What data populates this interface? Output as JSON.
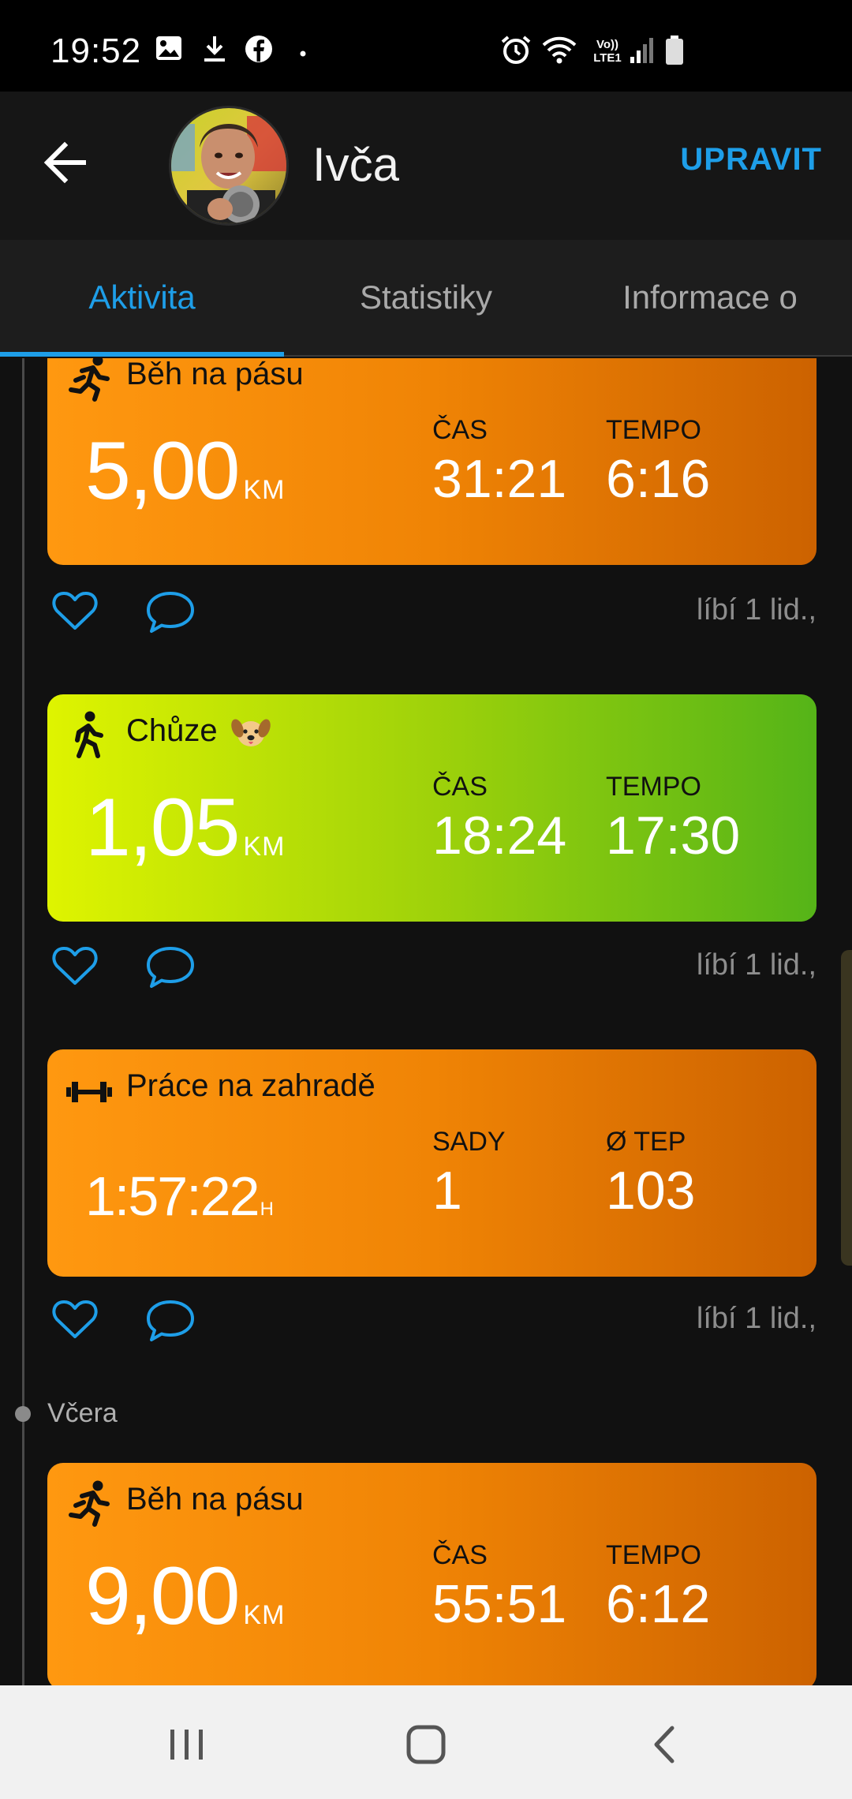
{
  "status_bar": {
    "time": "19:52",
    "icons": [
      "gallery-icon",
      "download-icon",
      "facebook-icon",
      "dot-icon",
      "alarm-icon",
      "wifi-icon",
      "volte-icon",
      "signal-icon",
      "battery-icon"
    ],
    "network_label": "Vo)) LTE1"
  },
  "header": {
    "back_icon": "arrow-left-icon",
    "name": "Ivča",
    "edit_label": "UPRAVIT"
  },
  "tabs": [
    {
      "label": "Aktivita",
      "active": true
    },
    {
      "label": "Statistiky",
      "active": false
    },
    {
      "label": "Informace o",
      "active": false
    }
  ],
  "feed": {
    "day_label": "Včera",
    "activities": [
      {
        "icon": "running-icon",
        "title": "Běh na pásu",
        "value": "5,00",
        "unit": "KM",
        "stat1_label": "ČAS",
        "stat1_value": "31:21",
        "stat2_label": "TEMPO",
        "stat2_value": "6:16",
        "likes": "líbí 1 lid.,",
        "color": "#f08405"
      },
      {
        "icon": "walking-icon",
        "title": "Chůze",
        "emoji": "dog-face-icon",
        "value": "1,05",
        "unit": "KM",
        "stat1_label": "ČAS",
        "stat1_value": "18:24",
        "stat2_label": "TEMPO",
        "stat2_value": "17:30",
        "likes": "líbí 1 lid.,",
        "color": "#9fd20a"
      },
      {
        "icon": "dumbbell-icon",
        "title": "Práce na zahradě",
        "value": "1:57:22",
        "unit": "H",
        "stat1_label": "SADY",
        "stat1_value": "1",
        "stat2_label": "Ø TEP",
        "stat2_value": "103",
        "likes": "líbí 1 lid.,",
        "color": "#f08405"
      },
      {
        "icon": "running-icon",
        "title": "Běh na pásu",
        "value": "9,00",
        "unit": "KM",
        "stat1_label": "ČAS",
        "stat1_value": "55:51",
        "stat2_label": "TEMPO",
        "stat2_value": "6:12",
        "color": "#f08405"
      }
    ]
  },
  "nav_bar": [
    "recents-icon",
    "home-icon",
    "back-icon"
  ],
  "colors": {
    "accent": "#1e9ee8",
    "background": "#111111",
    "orange": "#f08405",
    "green": "#9fd20a"
  }
}
